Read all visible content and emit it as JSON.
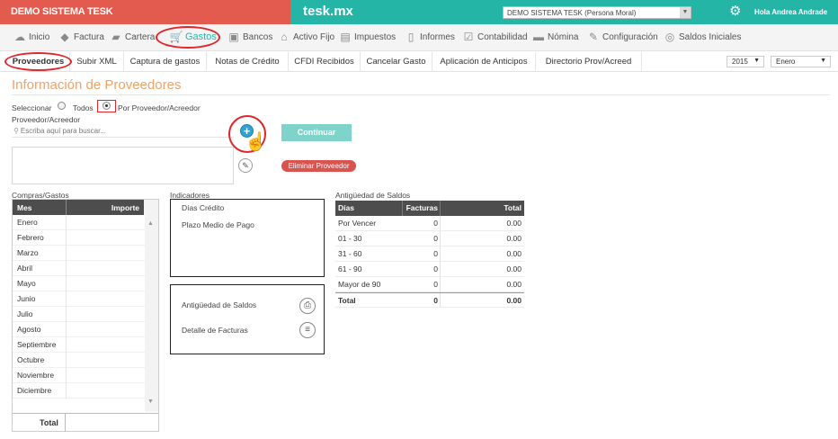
{
  "topbar": {
    "company": "DEMO SISTEMA TESK",
    "brand": "tesk.mx",
    "company_select": "DEMO SISTEMA TESK (Persona Moral)",
    "greeting": "Hola Andrea Andrade"
  },
  "mainnav": {
    "items": [
      {
        "label": "Inicio",
        "icon": "cloud-icon"
      },
      {
        "label": "Factura",
        "icon": "tag-icon"
      },
      {
        "label": "Cartera",
        "icon": "wallet-icon"
      },
      {
        "label": "Gastos",
        "icon": "cart-icon"
      },
      {
        "label": "Bancos",
        "icon": "bank-card-icon"
      },
      {
        "label": "Activo Fijo",
        "icon": "house-icon"
      },
      {
        "label": "Impuestos",
        "icon": "briefcase-icon"
      },
      {
        "label": "Informes",
        "icon": "document-icon"
      },
      {
        "label": "Contabilidad",
        "icon": "clipboard-icon"
      },
      {
        "label": "Nómina",
        "icon": "id-card-icon"
      },
      {
        "label": "Configuración",
        "icon": "wrench-icon"
      },
      {
        "label": "Saldos Iniciales",
        "icon": "coins-icon"
      }
    ],
    "active": "Gastos"
  },
  "subnav": {
    "tabs": [
      "Proveedores",
      "Subir XML",
      "Captura de gastos",
      "Notas de Crédito",
      "CFDI Recibidos",
      "Cancelar Gasto",
      "Aplicación de Anticipos",
      "Directorio Prov/Acreed"
    ],
    "year": "2015",
    "month": "Enero"
  },
  "page": {
    "title": "Información de Proveedores",
    "select_label": "Seleccionar",
    "option_all": "Todos",
    "option_by": "Por Proveedor/Acreedor",
    "provider_label": "Proveedor/Acreedor",
    "search_placeholder": "Escriba aquí para buscar...",
    "continue_label": "Continuar",
    "delete_label": "Eliminar Proveedor"
  },
  "compras": {
    "title": "Compras/Gastos",
    "col_mes": "Mes",
    "col_importe": "Importe",
    "months": [
      "Enero",
      "Febrero",
      "Marzo",
      "Abril",
      "Mayo",
      "Junio",
      "Julio",
      "Agosto",
      "Septiembre",
      "Octubre",
      "Noviembre",
      "Diciembre"
    ],
    "total_label": "Total"
  },
  "indicadores": {
    "title": "Indicadores",
    "dias_credito": "Días Crédito",
    "plazo_medio": "Plazo Medio de Pago",
    "report_saldos": "Antigüedad de Saldos",
    "report_facturas": "Detalle de Facturas"
  },
  "antiguedad": {
    "title": "Antigüedad de Saldos",
    "headers": [
      "Días",
      "Facturas",
      "Total"
    ],
    "rows": [
      [
        "Por Vencer",
        "0",
        "0.00"
      ],
      [
        "01 - 30",
        "0",
        "0.00"
      ],
      [
        "31 - 60",
        "0",
        "0.00"
      ],
      [
        "61 - 90",
        "0",
        "0.00"
      ],
      [
        "Mayor de 90",
        "0",
        "0.00"
      ]
    ],
    "total": [
      "Total",
      "0",
      "0.00"
    ]
  }
}
